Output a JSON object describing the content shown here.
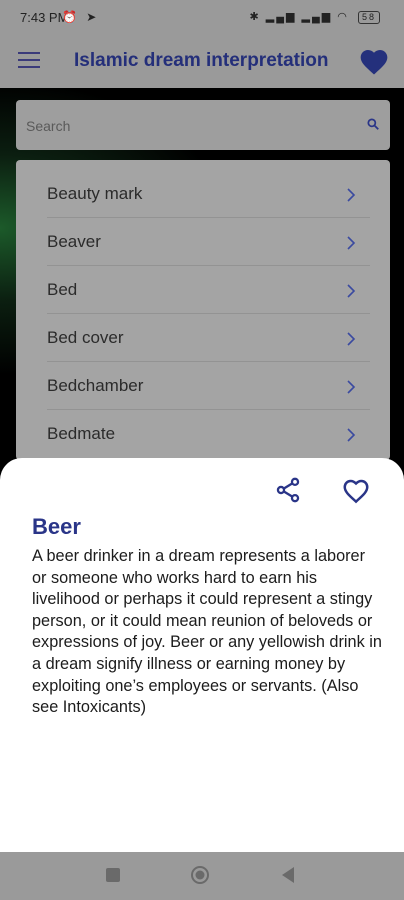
{
  "status_bar": {
    "time": "7:43 PM",
    "left_icons": "⏰ ➤",
    "right_icons": "✱ ▂▄▆ ▂▄▆ ◠",
    "battery": "58"
  },
  "app_bar": {
    "title": "Islamic dream interpretation",
    "menu_icon": "hamburger-menu-icon",
    "favorites_icon": "heart-filled-icon"
  },
  "search": {
    "placeholder": "Search",
    "value": ""
  },
  "list": {
    "items": [
      {
        "label": "Beauty mark"
      },
      {
        "label": "Beaver"
      },
      {
        "label": "Bed"
      },
      {
        "label": "Bed cover"
      },
      {
        "label": "Bedchamber"
      },
      {
        "label": "Bedmate"
      }
    ]
  },
  "detail": {
    "title": "Beer",
    "body": "A beer drinker in a dream represents a laborer or someone who works hard to earn his livelihood or perhaps it could represent a stingy person, or it could mean reunion of beloveds or expressions of joy. Beer or any yellowish drink in a dream signify illness or earning money by exploiting one’s employees or servants. (Also see Intoxicants)"
  },
  "colors": {
    "accent": "#2a3588",
    "scrim": "#9a9a9a",
    "sheet": "#ffffff"
  },
  "nav_bar": {
    "icons": [
      "recents-square-icon",
      "home-circle-icon",
      "back-triangle-icon"
    ]
  }
}
